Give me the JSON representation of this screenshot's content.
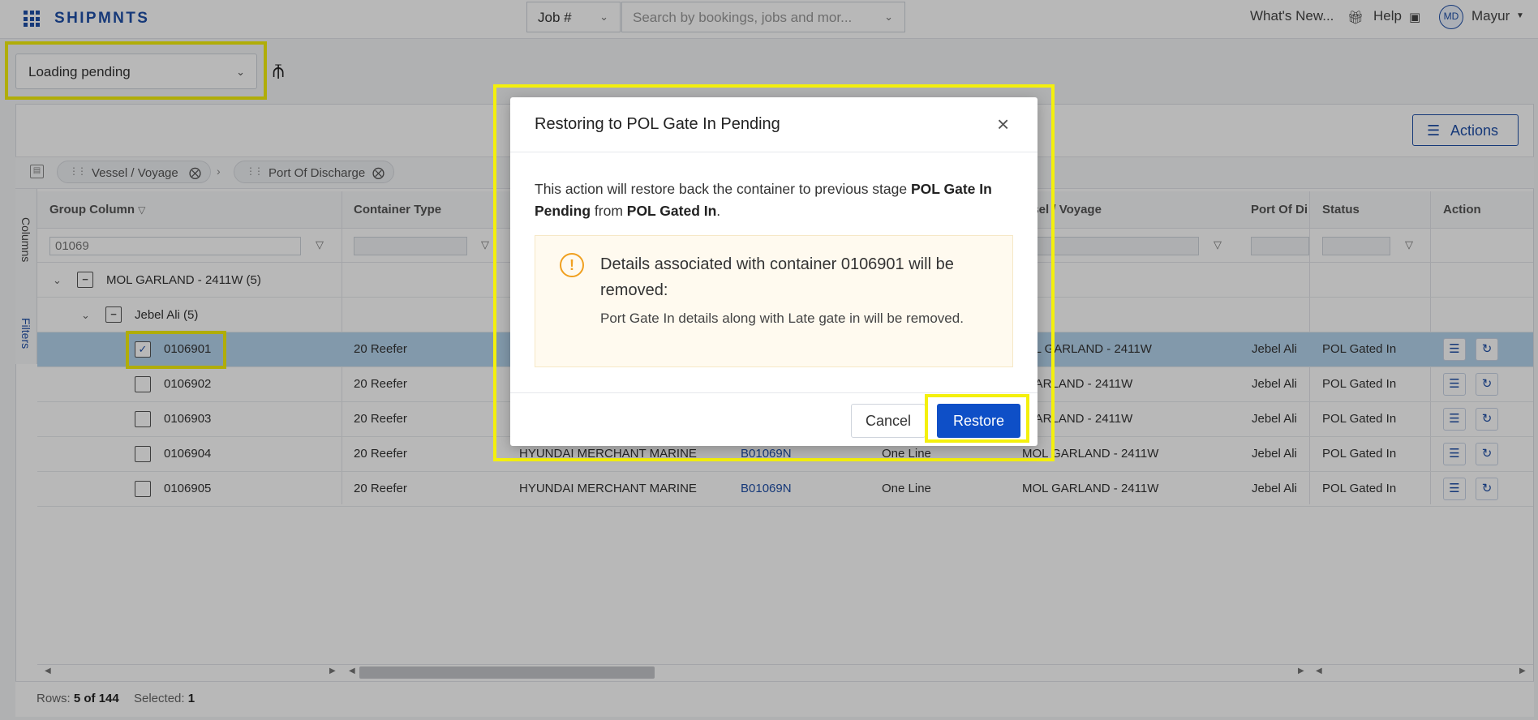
{
  "topbar": {
    "brand": "SHIPMNTS",
    "job_select": "Job #",
    "search_placeholder": "Search by bookings, jobs and mor...",
    "whats_new": "What's New...",
    "help": "Help",
    "avatar_initials": "MD",
    "user_name": "Mayur"
  },
  "view": {
    "selected": "Loading pending"
  },
  "toolbar": {
    "actions_label": "Actions"
  },
  "group_bar": {
    "chips": [
      "Vessel / Voyage",
      "Port Of Discharge"
    ]
  },
  "side_tabs": {
    "columns": "Columns",
    "filters": "Filters"
  },
  "columns": {
    "group": "Group Column",
    "container_type": "Container Type",
    "vessel_voyage": "ssel / Voyage",
    "port": "Port Of Di",
    "status": "Status",
    "action": "Action"
  },
  "filters": {
    "group_value": "01069"
  },
  "groups": {
    "level1": "MOL GARLAND - 2411W (5)",
    "level2": "Jebel Ali (5)"
  },
  "rows": [
    {
      "id": "0106901",
      "type": "20 Reefer",
      "carrier": "",
      "booking": "",
      "line": "",
      "vessel": "OL GARLAND - 2411W",
      "port": "Jebel Ali",
      "status": "POL Gated In",
      "checked": true
    },
    {
      "id": "0106902",
      "type": "20 Reefer",
      "carrier": "",
      "booking": "",
      "line": "",
      "vessel": "GARLAND - 2411W",
      "port": "Jebel Ali",
      "status": "POL Gated In",
      "checked": false
    },
    {
      "id": "0106903",
      "type": "20 Reefer",
      "carrier": "",
      "booking": "",
      "line": "",
      "vessel": "GARLAND - 2411W",
      "port": "Jebel Ali",
      "status": "POL Gated In",
      "checked": false
    },
    {
      "id": "0106904",
      "type": "20 Reefer",
      "carrier": "HYUNDAI MERCHANT MARINE",
      "booking": "B01069N",
      "line": "One Line",
      "vessel": "MOL GARLAND - 2411W",
      "port": "Jebel Ali",
      "status": "POL Gated In",
      "checked": false
    },
    {
      "id": "0106905",
      "type": "20 Reefer",
      "carrier": "HYUNDAI MERCHANT MARINE",
      "booking": "B01069N",
      "line": "One Line",
      "vessel": "MOL GARLAND - 2411W",
      "port": "Jebel Ali",
      "status": "POL Gated In",
      "checked": false
    }
  ],
  "footer": {
    "rows_label": "Rows:",
    "rows_value": "5 of 144",
    "selected_label": "Selected:",
    "selected_value": "1"
  },
  "modal": {
    "title": "Restoring to POL Gate In Pending",
    "body_pre": "This action will restore back the container to previous stage ",
    "body_stage": "POL Gate In Pending",
    "body_mid": " from ",
    "body_from": "POL Gated In",
    "body_end": ".",
    "notice_title": "Details associated with container 0106901 will be removed:",
    "notice_text": "Port Gate In details along with Late gate in will be removed.",
    "cancel_label": "Cancel",
    "restore_label": "Restore"
  },
  "icons": {
    "apps": "apps-grid-icon",
    "gift": "gift-icon",
    "chat": "chat-icon",
    "pin": "pin-icon",
    "list": "list-icon",
    "restore": "restore-icon",
    "warning": "warning-icon",
    "close": "close-icon"
  },
  "colors": {
    "brand": "#1f4fa8",
    "primary_button": "#0e4fc7",
    "selected_row": "#b5d4ee",
    "highlight": "#f4f00d",
    "warning": "#f0a020"
  }
}
